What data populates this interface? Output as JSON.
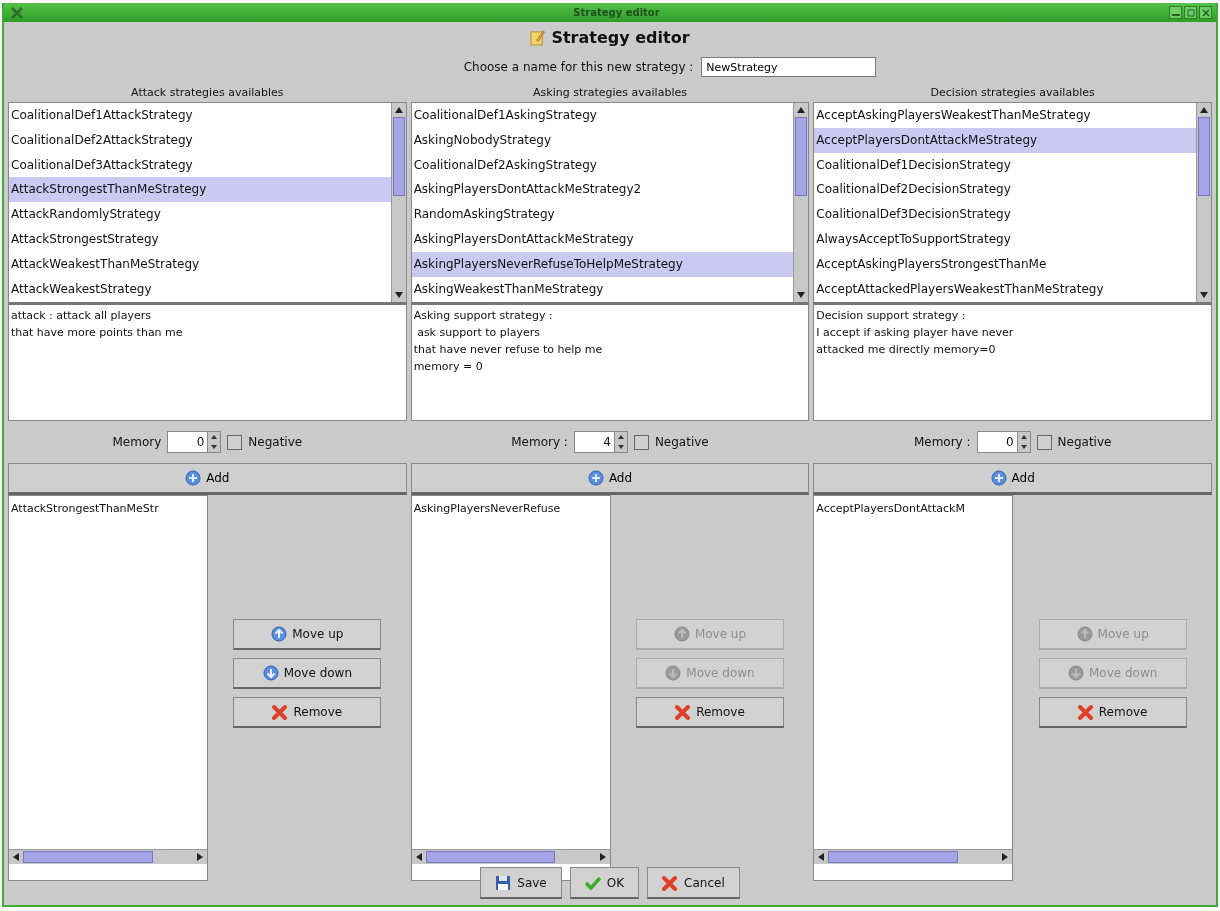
{
  "window": {
    "title": "Strategy editor"
  },
  "header": {
    "title": "Strategy editor"
  },
  "name_field": {
    "label": "Choose a name for this new strategy :",
    "value": "NewStrategy"
  },
  "columns": [
    {
      "heading": "Attack strategies availables",
      "items": [
        {
          "label": "CoalitionalDef1AttackStrategy",
          "selected": false
        },
        {
          "label": "CoalitionalDef2AttackStrategy",
          "selected": false
        },
        {
          "label": "CoalitionalDef3AttackStrategy",
          "selected": false
        },
        {
          "label": "AttackStrongestThanMeStrategy",
          "selected": true
        },
        {
          "label": "AttackRandomlyStrategy",
          "selected": false
        },
        {
          "label": "AttackStrongestStrategy",
          "selected": false
        },
        {
          "label": "AttackWeakestThanMeStrategy",
          "selected": false
        },
        {
          "label": "AttackWeakestStrategy",
          "selected": false
        }
      ],
      "description": [
        "attack : attack all players",
        "that have more points than me"
      ],
      "memory": {
        "label": "Memory",
        "value": "0"
      },
      "negative": {
        "label": "Negative",
        "checked": false
      },
      "add_button": "Add",
      "chosen": [
        "AttackStrongestThanMeStr"
      ],
      "buttons": [
        {
          "label": "Move up",
          "kind": "up",
          "disabled": false
        },
        {
          "label": "Move down",
          "kind": "down",
          "disabled": false
        },
        {
          "label": "Remove",
          "kind": "remove",
          "disabled": false
        }
      ]
    },
    {
      "heading": "Asking strategies availables",
      "items": [
        {
          "label": "CoalitionalDef1AskingStrategy",
          "selected": false
        },
        {
          "label": "AskingNobodyStrategy",
          "selected": false
        },
        {
          "label": "CoalitionalDef2AskingStrategy",
          "selected": false
        },
        {
          "label": "AskingPlayersDontAttackMeStrategy2",
          "selected": false
        },
        {
          "label": "RandomAskingStrategy",
          "selected": false
        },
        {
          "label": "AskingPlayersDontAttackMeStrategy",
          "selected": false
        },
        {
          "label": "AskingPlayersNeverRefuseToHelpMeStrategy",
          "selected": true
        },
        {
          "label": "AskingWeakestThanMeStrategy",
          "selected": false
        }
      ],
      "description": [
        "Asking support strategy :",
        " ask support to players",
        "that have never refuse to help me",
        "memory = 0"
      ],
      "memory": {
        "label": "Memory :",
        "value": "4"
      },
      "negative": {
        "label": "Negative",
        "checked": false
      },
      "add_button": "Add",
      "chosen": [
        "AskingPlayersNeverRefuse"
      ],
      "buttons": [
        {
          "label": "Move up",
          "kind": "up",
          "disabled": true
        },
        {
          "label": "Move down",
          "kind": "down",
          "disabled": true
        },
        {
          "label": "Remove",
          "kind": "remove",
          "disabled": false
        }
      ]
    },
    {
      "heading": "Decision strategies availables",
      "items": [
        {
          "label": "AcceptAskingPlayersWeakestThanMeStrategy",
          "selected": false
        },
        {
          "label": "AcceptPlayersDontAttackMeStrategy",
          "selected": true
        },
        {
          "label": "CoalitionalDef1DecisionStrategy",
          "selected": false
        },
        {
          "label": "CoalitionalDef2DecisionStrategy",
          "selected": false
        },
        {
          "label": "CoalitionalDef3DecisionStrategy",
          "selected": false
        },
        {
          "label": "AlwaysAcceptToSupportStrategy",
          "selected": false
        },
        {
          "label": "AcceptAskingPlayersStrongestThanMe",
          "selected": false
        },
        {
          "label": "AcceptAttackedPlayersWeakestThanMeStrategy",
          "selected": false
        }
      ],
      "description": [
        "Decision support strategy :",
        "I accept if asking player have never",
        "attacked me directly memory=0"
      ],
      "memory": {
        "label": "Memory :",
        "value": "0"
      },
      "negative": {
        "label": "Negative",
        "checked": false
      },
      "add_button": "Add",
      "chosen": [
        "AcceptPlayersDontAttackM"
      ],
      "buttons": [
        {
          "label": "Move up",
          "kind": "up",
          "disabled": true
        },
        {
          "label": "Move down",
          "kind": "down",
          "disabled": true
        },
        {
          "label": "Remove",
          "kind": "remove",
          "disabled": false
        }
      ]
    }
  ],
  "footer_buttons": [
    {
      "label": "Save",
      "kind": "save"
    },
    {
      "label": "OK",
      "kind": "ok"
    },
    {
      "label": "Cancel",
      "kind": "cancel"
    }
  ]
}
